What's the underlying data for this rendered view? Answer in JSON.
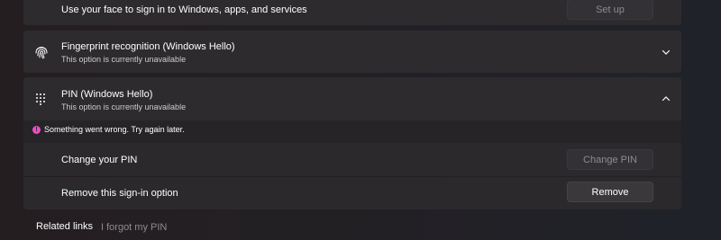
{
  "face": {
    "description": "Use your face to sign in to Windows, apps, and services",
    "button_label": "Set up"
  },
  "fingerprint": {
    "title": "Fingerprint recognition (Windows Hello)",
    "subtitle": "This option is currently unavailable",
    "icon": "fingerprint-icon"
  },
  "pin": {
    "title": "PIN (Windows Hello)",
    "subtitle": "This option is currently unavailable",
    "icon": "keypad-icon",
    "error": "Something went wrong. Try again later.",
    "change_label": "Change your PIN",
    "change_button": "Change PIN",
    "remove_label": "Remove this sign-in option",
    "remove_button": "Remove"
  },
  "related": {
    "label": "Related links",
    "link": "I forgot my PIN"
  },
  "colors": {
    "error_accent": "#e94fc8"
  }
}
